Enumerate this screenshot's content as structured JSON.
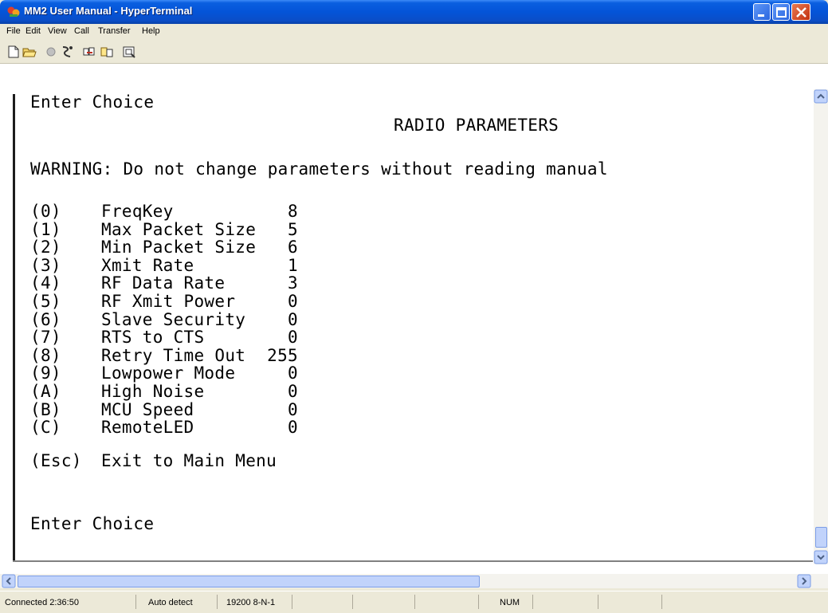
{
  "window": {
    "title": "MM2 User Manual - HyperTerminal"
  },
  "menu": [
    "File",
    "Edit",
    "View",
    "Call",
    "Transfer",
    "Help"
  ],
  "toolbar": [
    "new-icon",
    "open-icon",
    "disconnect-icon",
    "dial-icon",
    "send-icon",
    "receive-icon",
    "properties-icon"
  ],
  "terminal": {
    "header_prompt": "Enter Choice",
    "title": "RADIO PARAMETERS",
    "warning": "WARNING: Do not change parameters without reading manual",
    "params": [
      {
        "key": "(0)",
        "name": "FreqKey",
        "value": "8"
      },
      {
        "key": "(1)",
        "name": "Max Packet Size",
        "value": "5"
      },
      {
        "key": "(2)",
        "name": "Min Packet Size",
        "value": "6"
      },
      {
        "key": "(3)",
        "name": "Xmit Rate",
        "value": "1"
      },
      {
        "key": "(4)",
        "name": "RF Data Rate",
        "value": "3"
      },
      {
        "key": "(5)",
        "name": "RF Xmit Power",
        "value": "0"
      },
      {
        "key": "(6)",
        "name": "Slave Security",
        "value": "0"
      },
      {
        "key": "(7)",
        "name": "RTS to CTS",
        "value": "0"
      },
      {
        "key": "(8)",
        "name": "Retry Time Out",
        "value": "255"
      },
      {
        "key": "(9)",
        "name": "Lowpower Mode",
        "value": "0"
      },
      {
        "key": "(A)",
        "name": "High Noise",
        "value": "0"
      },
      {
        "key": "(B)",
        "name": "MCU Speed",
        "value": "0"
      },
      {
        "key": "(C)",
        "name": "RemoteLED",
        "value": "0"
      }
    ],
    "exit_key": "(Esc)",
    "exit_label": "Exit to Main Menu",
    "footer_prompt": "Enter Choice"
  },
  "status": {
    "connected": "Connected 2:36:50",
    "detect": "Auto detect",
    "settings": "19200 8-N-1",
    "num": "NUM"
  }
}
